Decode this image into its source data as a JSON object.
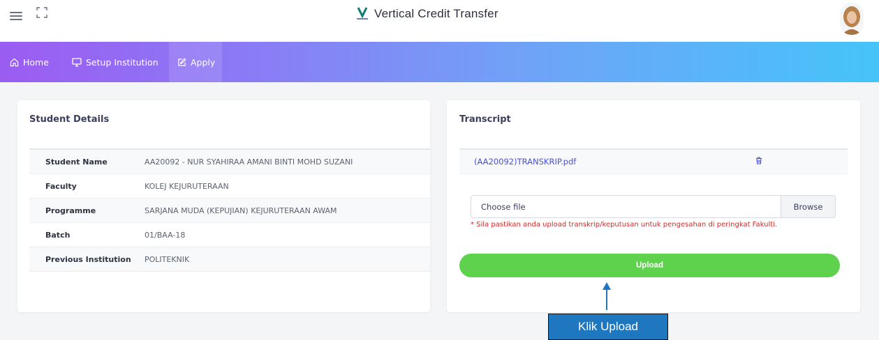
{
  "app": {
    "title": "Vertical Credit Transfer",
    "brand_color": "#0e7c74",
    "menu_icon": "hamburger-icon",
    "fullscreen_icon": "fullscreen-icon",
    "avatar": "user-avatar"
  },
  "nav": {
    "items": [
      {
        "label": "Home",
        "icon": "home-icon"
      },
      {
        "label": "Setup Institution",
        "icon": "monitor-icon"
      },
      {
        "label": "Apply",
        "icon": "edit-icon",
        "active": true
      }
    ],
    "gradient": [
      "#9b5cf2",
      "#45c4f9"
    ]
  },
  "student": {
    "title": "Student Details",
    "rows": [
      {
        "label": "Student Name",
        "value": "AA20092 - NUR SYAHIRAA AMANI BINTI MOHD SUZANI"
      },
      {
        "label": "Faculty",
        "value": "KOLEJ KEJURUTERAAN"
      },
      {
        "label": "Programme",
        "value": "SARJANA MUDA (KEPUJIAN) KEJURUTERAAN AWAM"
      },
      {
        "label": "Batch",
        "value": "01/BAA-18"
      },
      {
        "label": "Previous Institution",
        "value": "POLITEKNIK"
      }
    ]
  },
  "transcript": {
    "title": "Transcript",
    "file_name": "(AA20092)TRANSKRIP.pdf",
    "delete_icon": "trash-icon",
    "choose_file": "Choose file",
    "browse": "Browse",
    "hint": "* Sila pastikan anda upload transkrip/keputusan untuk pengesahan di peringkat Fakulti.",
    "upload_label": "Upload",
    "upload_color": "#5ed24c"
  },
  "annotation": {
    "callout": "Klik Upload",
    "color": "#1f78bf"
  }
}
